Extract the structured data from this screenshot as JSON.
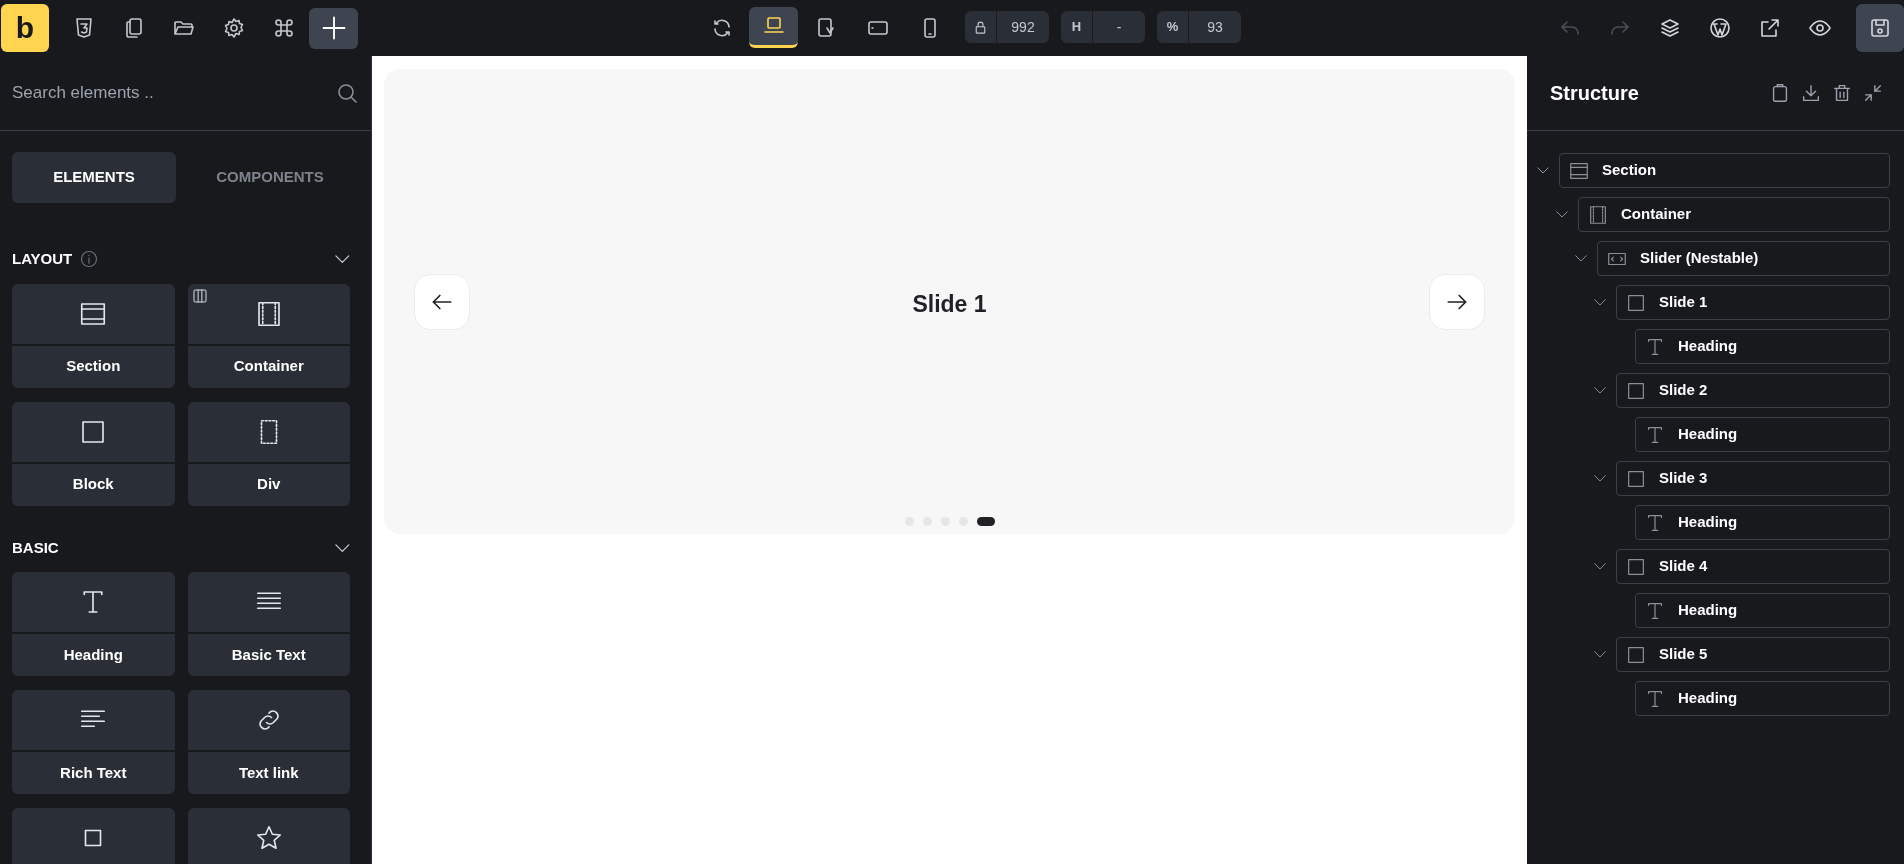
{
  "topbar": {
    "logo": "b",
    "tools": [
      {
        "kind": "css"
      },
      {
        "kind": "pages"
      },
      {
        "kind": "folder"
      },
      {
        "kind": "settings"
      },
      {
        "kind": "command"
      },
      {
        "kind": "add",
        "selected": true
      }
    ],
    "viewports": [
      {
        "kind": "refresh",
        "selected": false
      },
      {
        "kind": "laptop",
        "selected": true
      },
      {
        "kind": "tablet-rotate",
        "selected": false
      },
      {
        "kind": "tablet",
        "selected": false
      },
      {
        "kind": "phone",
        "selected": false
      }
    ],
    "fields": [
      {
        "kind": "lock",
        "value": "992"
      },
      {
        "label": "H",
        "value": "-"
      },
      {
        "label": "%",
        "value": "93"
      }
    ],
    "actions": [
      {
        "kind": "undo",
        "disabled": true
      },
      {
        "kind": "redo",
        "disabled": true
      },
      {
        "kind": "layers",
        "disabled": false
      },
      {
        "kind": "wordpress",
        "disabled": false
      },
      {
        "kind": "external",
        "disabled": false
      },
      {
        "kind": "preview",
        "disabled": false
      },
      {
        "kind": "save",
        "disabled": false
      }
    ]
  },
  "sidebar": {
    "search": {
      "placeholder": "Search elements .."
    },
    "tabs": [
      {
        "label": "ELEMENTS",
        "selected": true
      },
      {
        "label": "COMPONENTS",
        "selected": false
      }
    ],
    "groups": [
      {
        "title": "LAYOUT",
        "info": true,
        "expanded": true,
        "items": [
          {
            "kind": "section",
            "label": "Section"
          },
          {
            "kind": "container",
            "label": "Container"
          },
          {
            "kind": "block",
            "label": "Block"
          },
          {
            "kind": "div",
            "label": "Div"
          }
        ]
      },
      {
        "title": "BASIC",
        "info": false,
        "expanded": true,
        "items": [
          {
            "kind": "heading",
            "label": "Heading"
          },
          {
            "kind": "basic-text",
            "label": "Basic Text"
          },
          {
            "kind": "rich-text",
            "label": "Rich Text"
          },
          {
            "kind": "text-link",
            "label": "Text link"
          },
          {
            "kind": "button"
          },
          {
            "kind": "star"
          }
        ]
      }
    ]
  },
  "canvas": {
    "slider": {
      "title": "Slide 1",
      "dots": [
        {
          "selected": false
        },
        {
          "selected": false
        },
        {
          "selected": false
        },
        {
          "selected": false
        },
        {
          "selected": true
        }
      ]
    }
  },
  "structure": {
    "title": "Structure",
    "tree": [
      {
        "kind": "section",
        "label": "Section",
        "expanded": true,
        "children": [
          {
            "kind": "container",
            "label": "Container",
            "expanded": true,
            "children": [
              {
                "kind": "slider",
                "label": "Slider (Nestable)",
                "expanded": true,
                "children": [
                  {
                    "kind": "block",
                    "label": "Slide 1",
                    "expanded": true,
                    "children": [
                      {
                        "kind": "heading",
                        "label": "Heading"
                      }
                    ]
                  },
                  {
                    "kind": "block",
                    "label": "Slide 2",
                    "expanded": true,
                    "children": [
                      {
                        "kind": "heading",
                        "label": "Heading"
                      }
                    ]
                  },
                  {
                    "kind": "block",
                    "label": "Slide 3",
                    "expanded": true,
                    "children": [
                      {
                        "kind": "heading",
                        "label": "Heading"
                      }
                    ]
                  },
                  {
                    "kind": "block",
                    "label": "Slide 4",
                    "expanded": true,
                    "children": [
                      {
                        "kind": "heading",
                        "label": "Heading"
                      }
                    ]
                  },
                  {
                    "kind": "block",
                    "label": "Slide 5",
                    "expanded": true,
                    "children": [
                      {
                        "kind": "heading",
                        "label": "Heading"
                      }
                    ]
                  }
                ]
              }
            ]
          }
        ]
      }
    ]
  }
}
